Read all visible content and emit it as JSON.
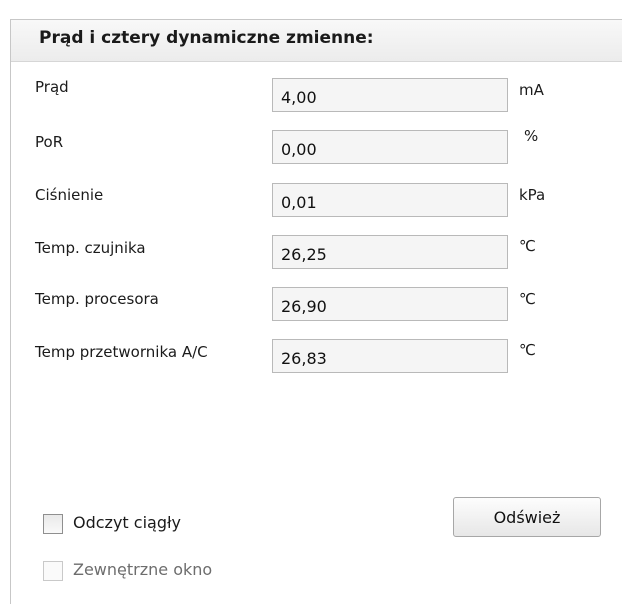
{
  "panel": {
    "title": "Prąd i cztery dynamiczne zmienne:"
  },
  "rows": [
    {
      "label": "Prąd",
      "value": "4,00",
      "unit": "mA"
    },
    {
      "label": "PoR",
      "value": "0,00",
      "unit": "%"
    },
    {
      "label": "Ciśnienie",
      "value": "0,01",
      "unit": "kPa"
    },
    {
      "label": "Temp. czujnika",
      "value": "26,25",
      "unit": "℃"
    },
    {
      "label": "Temp. procesora",
      "value": "26,90",
      "unit": "℃"
    },
    {
      "label": "Temp przetwornika A/C",
      "value": "26,83",
      "unit": "℃"
    }
  ],
  "refresh_button": {
    "label": "Odśwież"
  },
  "checkboxes": {
    "continuous": {
      "label": "Odczyt ciągły",
      "checked": false,
      "enabled": true
    },
    "external": {
      "label": "Zewnętrzne okno",
      "checked": false,
      "enabled": false
    }
  }
}
